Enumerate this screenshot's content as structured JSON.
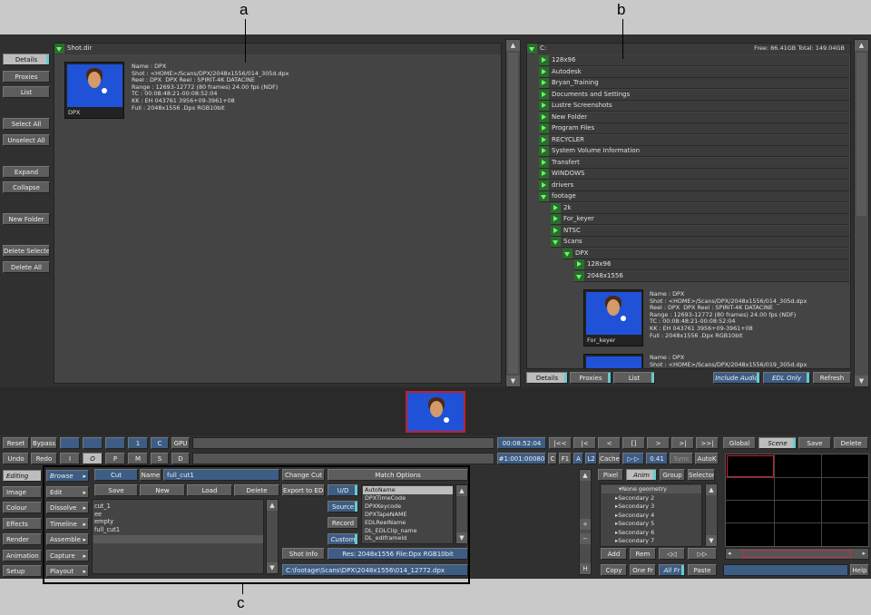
{
  "callouts": {
    "a": "a",
    "b": "b",
    "c": "c"
  },
  "left_buttons": {
    "details": "Details",
    "proxies": "Proxies",
    "list": "List",
    "select_all": "Select All",
    "unselect_all": "Unselect All",
    "expand": "Expand",
    "collapse": "Collapse",
    "new_folder": "New Folder",
    "delete_selected": "Delete Selected",
    "delete_all": "Delete All"
  },
  "shot_panel": {
    "header": "Shot.dir",
    "thumb_label": "DPX",
    "meta": "Name : DPX\nShot : <HOME>/Scans/DPX/2048x1556/014_305d.dpx\nReel : DPX  DPX Reel : SPIRIT-4K DATACINE\nRange : 12693-12772 (80 frames) 24.00 fps (NDF)\nTC : 00:08:48:21-00:08:52:04\nKK : EH 043761 3956+09-3961+08\nFull : 2048x1556 .Dpx RGB10bit"
  },
  "tree": {
    "drive": "C:",
    "space": "Free: 86.41GB Total: 149.04GB",
    "items": [
      "128x96",
      "Autodesk",
      "Bryan_Training",
      "Documents and Settings",
      "Lustre Screenshots",
      "New Folder",
      "Program Files",
      "RECYCLER",
      "System Volume Information",
      "Transfert",
      "WINDOWS",
      "drivers",
      "footage"
    ],
    "footage_items": [
      "2k",
      "For_keyer",
      "NTSC",
      "Scans"
    ],
    "scans_items": [
      "DPX"
    ],
    "dpx_items": [
      "128x96",
      "2048x1556"
    ],
    "entry1_label": "For_keyer",
    "entry1_meta": "Name : DPX\nShot : <HOME>/Scans/DPX/2048x1556/014_305d.dpx\nReel : DPX  DPX Reel : SPIRIT-4K DATACINE\nRange : 12693-12772 (80 frames) 24.00 fps (NDF)\nTC : 00:08:48:21-00:08:52:04\nKK : EH 043761 3956+09-3961+08\nFull : 2048x1556 .Dpx RGB10bit",
    "entry2_meta": "Name : DPX\nShot : <HOME>/Scans/DPX/2048x1556/019_305d.dpx"
  },
  "right_tabs": {
    "details": "Details",
    "proxies": "Proxies",
    "list": "List",
    "include_audio": "Include Audio",
    "edl_only": "EDL Only",
    "refresh": "Refresh"
  },
  "transport": {
    "reset": "Reset",
    "bypass": "Bypass",
    "undo": "Undo",
    "redo": "Redo",
    "one": "1",
    "c": "C",
    "gpu": "GPU",
    "i": "I",
    "o": "O",
    "p": "P",
    "m": "M",
    "s": "S",
    "d": "D",
    "timecode": "00:08:52:04",
    "frame": "#1:001:00080",
    "c2": "C",
    "f1": "F1",
    "a": "A",
    "l2": "L2",
    "cache": "Cache",
    "speed": "0.41",
    "sync": "Sync",
    "autok": "AutoK",
    "global": "Global",
    "scene": "Scene",
    "save": "Save",
    "delete": "Delete",
    "play_icons": [
      "|<<",
      "|<",
      "<",
      "[]",
      ">",
      ">|",
      ">>|"
    ]
  },
  "menu": {
    "items": [
      "Editing",
      "Image",
      "Colour",
      "Effects",
      "Render",
      "Animation",
      "Setup"
    ],
    "sub": [
      "Browse",
      "Edit",
      "Dissolve",
      "Timeline",
      "Assemble",
      "Capture",
      "Playout"
    ]
  },
  "edit": {
    "cut": "Cut",
    "name_label": "Name",
    "name_value": "full_cut1",
    "save": "Save",
    "new": "New",
    "load": "Load",
    "delete": "Delete",
    "list": "cut_1\nee\nempty\nfull_cut1",
    "change_cut": "Change Cut",
    "export_edl": "Export to EDL",
    "shot_info": "Shot Info",
    "match_options": "Match Options",
    "ud": "U/D",
    "source": "Source",
    "record": "Record",
    "custom": "Custom",
    "match_list": [
      "AutoName",
      "DPXTimeCode",
      "DPXKeycode",
      "DPXTapeNAME",
      "EDLReelName",
      "DL_EDLClip_name",
      "DL_edlframeId"
    ],
    "res": "Res: 2048x1556 File:Dpx RGB10bit",
    "path": "C:\\footage\\Scans\\DPX\\2048x1556\\014_12772.dpx"
  },
  "geo": {
    "pixel": "Pixel",
    "anim": "Anim",
    "group": "Group",
    "selector": "Selector",
    "tree": [
      "None geometry",
      "Secondary 2",
      "Secondary 3",
      "Secondary 4",
      "Secondary 5",
      "Secondary 6",
      "Secondary 7"
    ],
    "add": "Add",
    "rem": "Rem",
    "copy": "Copy",
    "one_fr": "One Fr",
    "all_fr": "All Fr",
    "paste": "Paste",
    "help": "Help"
  },
  "colors": {
    "accent": "#66cccc",
    "blue": "#3d5d85",
    "thumb": "#1f52d6",
    "frame_red": "#c0202c"
  }
}
